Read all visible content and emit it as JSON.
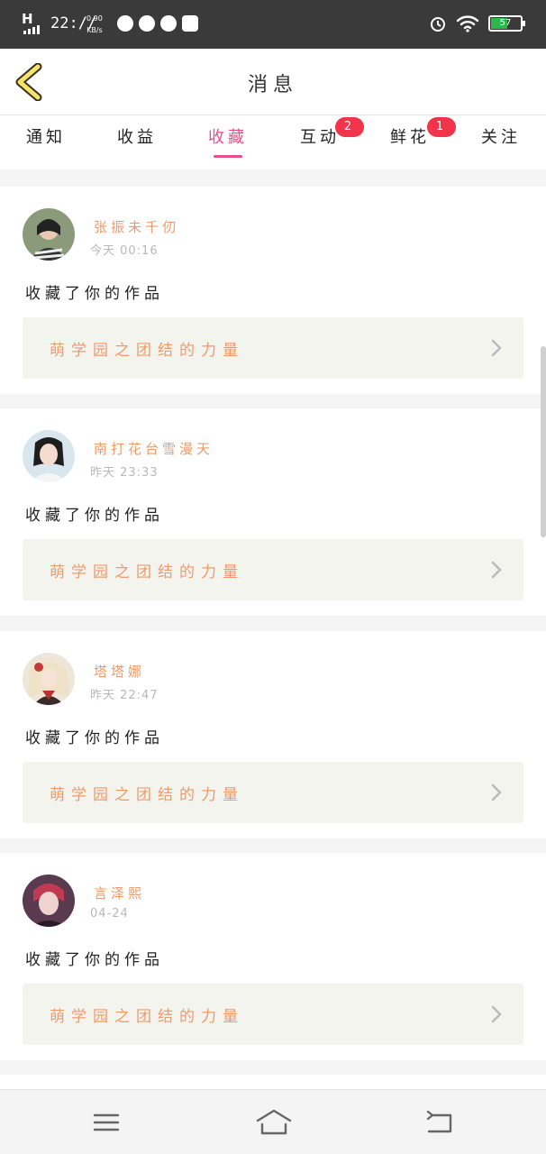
{
  "status_bar": {
    "network": "H",
    "time": "22://",
    "speed_value": "0.90",
    "speed_unit": "KB/s",
    "battery": "57"
  },
  "header": {
    "title": "消息",
    "back_icon": "chevron-left-icon"
  },
  "tabs": [
    {
      "label": "通知",
      "badge": ""
    },
    {
      "label": "收益",
      "badge": ""
    },
    {
      "label": "收藏",
      "badge": "",
      "active": true
    },
    {
      "label": "互动",
      "badge": "2"
    },
    {
      "label": "鲜花",
      "badge": "1"
    },
    {
      "label": "关注",
      "badge": ""
    }
  ],
  "notifications": [
    {
      "name": "张振未千仞",
      "time": "今天 00:16",
      "action": "收藏了你的作品",
      "work_title": "萌学园之团结的力量"
    },
    {
      "name": "南打花台雪漫天",
      "time": "昨天 23:33",
      "action": "收藏了你的作品",
      "work_title": "萌学园之团结的力量"
    },
    {
      "name": "塔塔娜",
      "time": "昨天 22:47",
      "action": "收藏了你的作品",
      "work_title": "萌学园之团结的力量"
    },
    {
      "name": "言泽熙",
      "time": "04-24",
      "action": "收藏了你的作品",
      "work_title": "萌学园之团结的力量"
    }
  ],
  "colors": {
    "accent": "#e94e8a",
    "badge": "#f2344a",
    "name": "#f09a6a",
    "card_inner": "#f4f4ee",
    "status_bar": "#3a3a3a"
  },
  "nav": {
    "menu_icon": "menu-icon",
    "home_icon": "home-icon",
    "back_icon": "back-icon"
  }
}
